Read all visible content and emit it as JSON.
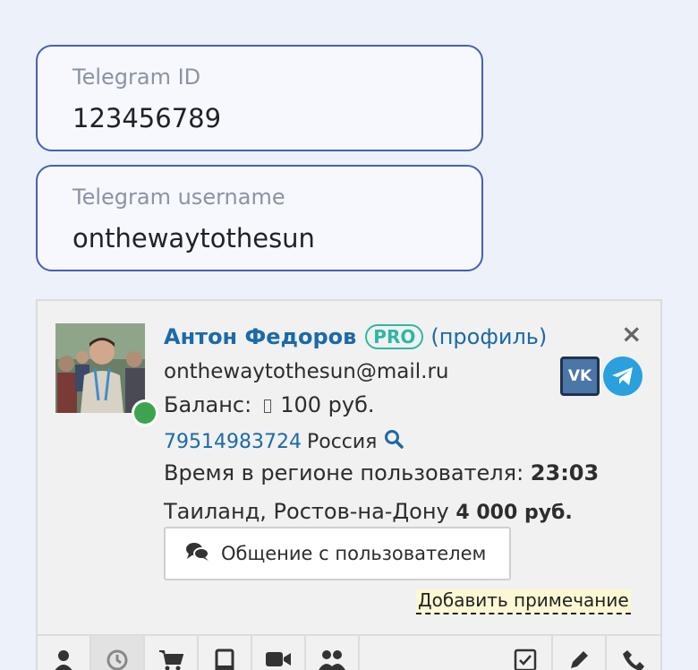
{
  "fields": {
    "telegram_id": {
      "label": "Telegram ID",
      "value": "123456789"
    },
    "telegram_username": {
      "label": "Telegram username",
      "value": "onthewaytothesun"
    }
  },
  "user": {
    "name": "Антон Федоров",
    "badge": "PRO",
    "profile_link": "(профиль)",
    "email": "onthewaytothesun@mail.ru",
    "balance_label": "Баланс:",
    "balance_value": "100 руб.",
    "phone": "79514983724",
    "country": "Россия",
    "region_time_label": "Время в регионе пользователя:",
    "region_time": "23:03",
    "location": "Таиланд, Ростов-на-Дону",
    "amount": "4 000 руб.",
    "online": true
  },
  "social": {
    "vk_label": "VK"
  },
  "actions": {
    "chat_label": "Общение с пользователем",
    "note_label": "Добавить примечание",
    "close_symbol": "×"
  },
  "toolbar": [
    {
      "icon": "user-icon"
    },
    {
      "icon": "history-icon",
      "active": true
    },
    {
      "icon": "cart-icon"
    },
    {
      "icon": "tablet-icon"
    },
    {
      "icon": "video-icon"
    },
    {
      "icon": "users-icon"
    },
    {
      "icon": "checkbox-icon"
    },
    {
      "icon": "pencil-icon"
    },
    {
      "icon": "phone-icon"
    }
  ],
  "colors": {
    "background": "#edf1fa",
    "field_border": "#4660b0",
    "link": "#1c6aa8",
    "pro_badge": "#2cb8a3",
    "online": "#3ca44f",
    "note_highlight": "#fbf8d3"
  }
}
